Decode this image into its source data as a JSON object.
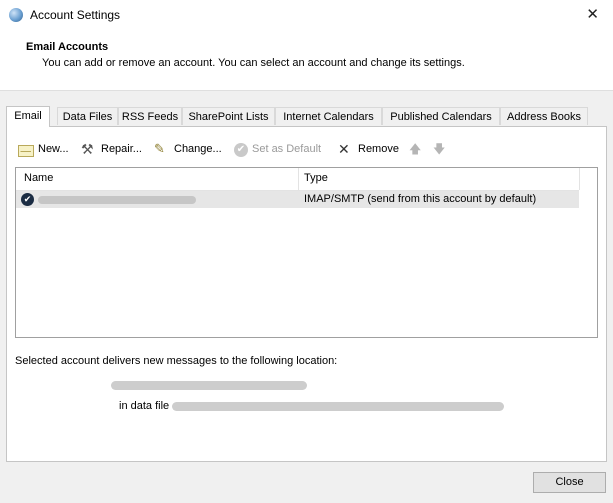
{
  "window": {
    "title": "Account Settings",
    "close_glyph": "✕"
  },
  "header": {
    "title": "Email Accounts",
    "description": "You can add or remove an account. You can select an account and change its settings."
  },
  "tabs": [
    {
      "label": "Email",
      "active": true
    },
    {
      "label": "Data Files",
      "active": false
    },
    {
      "label": "RSS Feeds",
      "active": false
    },
    {
      "label": "SharePoint Lists",
      "active": false
    },
    {
      "label": "Internet Calendars",
      "active": false
    },
    {
      "label": "Published Calendars",
      "active": false
    },
    {
      "label": "Address Books",
      "active": false
    }
  ],
  "toolbar": {
    "new_label": "New...",
    "repair_label": "Repair...",
    "change_label": "Change...",
    "set_default_label": "Set as Default",
    "remove_label": "Remove",
    "move_up_glyph": "🡅",
    "move_down_glyph": "🡇",
    "icons": {
      "new": "new-mail-icon",
      "repair": "repair-tools-icon",
      "change": "change-icon",
      "set_default": "check-circle-icon",
      "remove": "remove-x-icon"
    }
  },
  "accounts_table": {
    "columns": [
      "Name",
      "Type"
    ],
    "rows": [
      {
        "name": "",
        "type": "IMAP/SMTP (send from this account by default)",
        "default": true
      }
    ]
  },
  "delivery": {
    "label": "Selected account delivers new messages to the following location:",
    "in_data_file_prefix": "in data file"
  },
  "footer": {
    "close_label": "Close"
  },
  "colors": {
    "window_bg": "#f0f0f0",
    "header_bg": "#ffffff",
    "selected_row": "#e6e6e6",
    "default_badge": "#1b2c43"
  }
}
